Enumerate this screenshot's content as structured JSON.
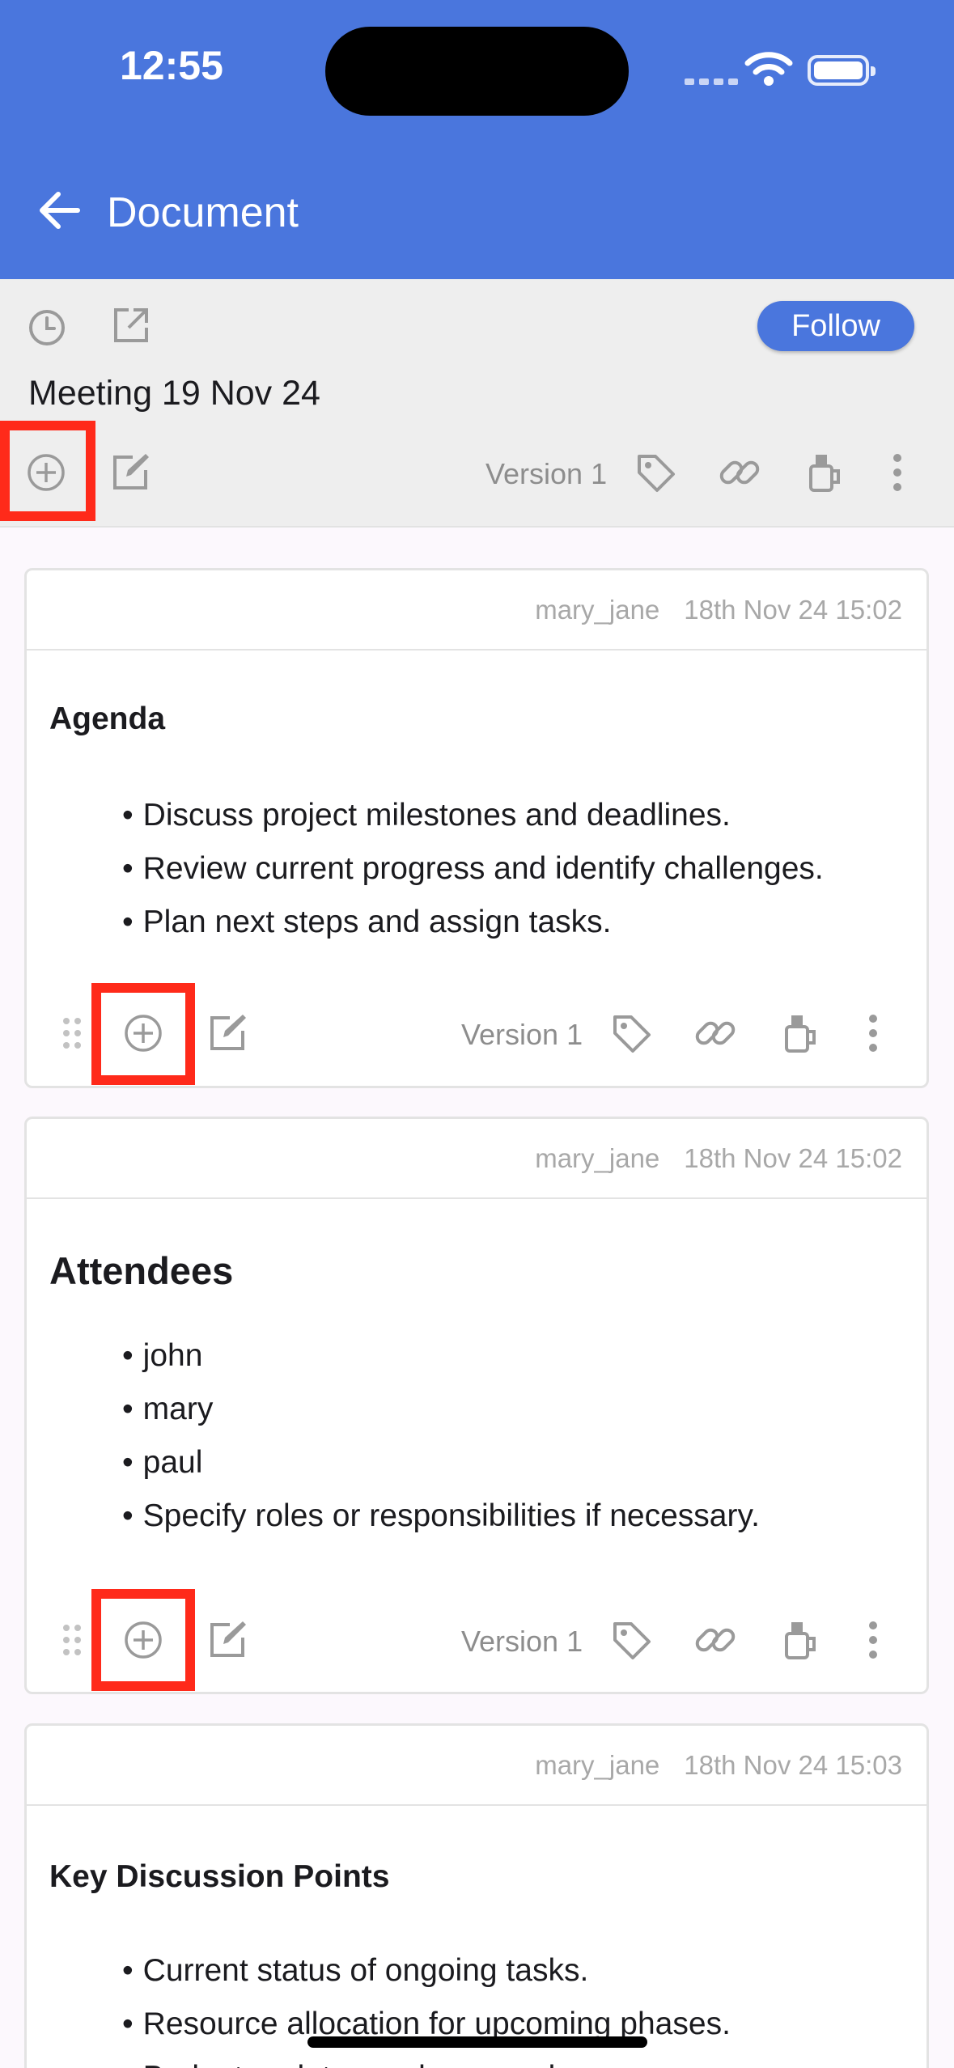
{
  "status_bar": {
    "time": "12:55"
  },
  "app_bar": {
    "title": "Document"
  },
  "doc_toolbar": {
    "follow_label": "Follow",
    "doc_name": "Meeting 19 Nov 24",
    "version_label": "Version 1"
  },
  "cards": [
    {
      "author": "mary_jane",
      "timestamp": "18th Nov 24 15:02",
      "heading": "Agenda",
      "bullets": [
        "Discuss project milestones and deadlines.",
        "Review current progress and identify challenges.",
        "Plan next steps and assign tasks."
      ],
      "version_label": "Version 1"
    },
    {
      "author": "mary_jane",
      "timestamp": "18th Nov 24 15:02",
      "heading": "Attendees",
      "bullets": [
        "john",
        "mary",
        "paul",
        "Specify roles or responsibilities if necessary."
      ],
      "version_label": "Version 1"
    },
    {
      "author": "mary_jane",
      "timestamp": "18th Nov 24 15:03",
      "heading": "Key Discussion Points",
      "bullets": [
        "Current status of ongoing tasks.",
        "Resource allocation for upcoming phases.",
        "Budget updates and approvals."
      ]
    }
  ],
  "colors": {
    "primary": "#4a76dd",
    "highlight": "#ff2a1a",
    "icon_gray": "#9a9a9a"
  }
}
